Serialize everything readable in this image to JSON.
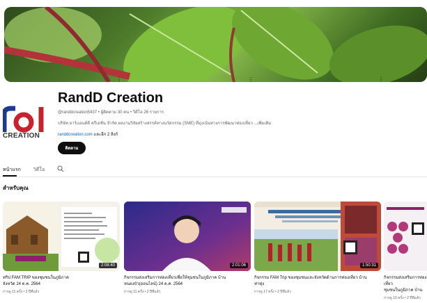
{
  "channel": {
    "name": "RandD Creation",
    "meta": "@randdcreation5437 • ผู้ติดตาม 30 คน • วิดีโอ 26 รายการ",
    "description": "บริษัท อาร์แอนด์ดี ครีเอชั่น จำกัด ผลงานวิจัยสร้างสรรค์ทางนวัตกรรม (SME) ที่มุ่งเน้นทางการพัฒนาท่องเที่ยว ...เพิ่มเติม",
    "link": "randdcreation.com",
    "link_more": "และอีก 2 ลิงก์",
    "subscribe_label": "ติดตาม",
    "logo_text": "CREATION"
  },
  "tabs": [
    {
      "label": "หน้าแรก"
    },
    {
      "label": "วิดีโอ"
    }
  ],
  "section": {
    "title": "สำหรับคุณ"
  },
  "videos": [
    {
      "title": "ทริป FAM TRIP ของชุมชนในภูมิภาค\nจังหวัด 24 ต.ค. 2564",
      "meta": "การดู 11 ครั้ง • 2 ปีที่แล้ว",
      "duration": "2:08:40"
    },
    {
      "title": "กิจกรรมส่งเสริมการท่องเที่ยวเพื่อให้ชุมชนในภูมิภาค บ้าน\nหนองบัว(ออนไลน์) 24 ต.ค. 2564",
      "meta": "การดู 11 ครั้ง • 2 ปีที่แล้ว",
      "duration": "2:01:06"
    },
    {
      "title": "กิจกรรม FAM Trip ของชุมชนและจังหวัดด้านการท่องเที่ยว บ้าน\nท่าทุ่ง",
      "meta": "การดู 17 ครั้ง • 2 ปีที่แล้ว",
      "duration": "1:50:31"
    },
    {
      "title": "กิจกรรมส่งเสริมการท่องเที่ยว\nชุมชนในภูมิภาค บ้าน",
      "meta": "การดู 10 ครั้ง • 2 ปีที่แล้ว",
      "duration": ""
    }
  ]
}
